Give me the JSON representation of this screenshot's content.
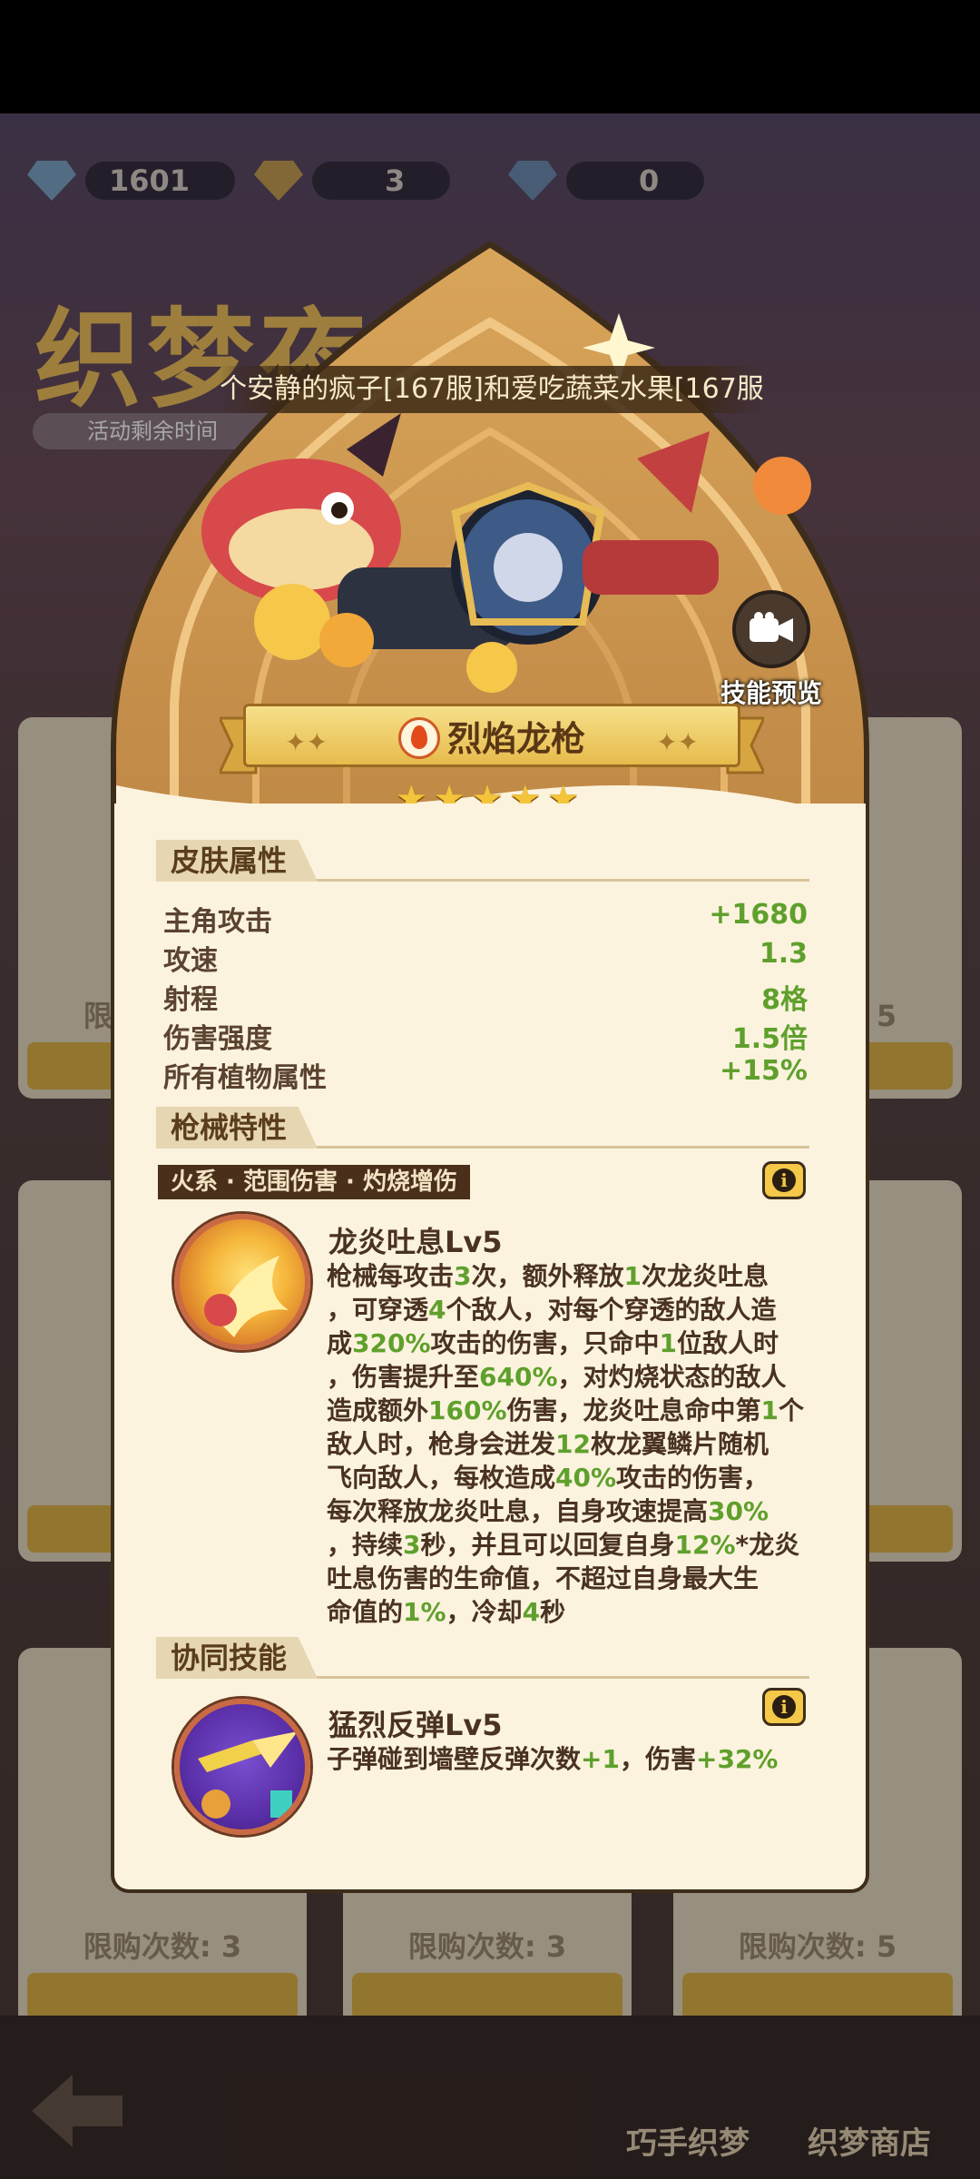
{
  "background": {
    "resources": [
      {
        "icon": "diamond-icon",
        "value": "1601"
      },
      {
        "icon": "mask-icon",
        "value": "3"
      },
      {
        "icon": "crystal-icon",
        "value": "0"
      }
    ],
    "title": "织梦夜",
    "timer_label": "活动剩余时间",
    "card_limit_text": [
      "限购次数: 3",
      "限购次数: 3",
      "限购次数: 5"
    ],
    "bottom_tabs": [
      "巧手织梦",
      "织梦商店"
    ]
  },
  "modal": {
    "banner_prefix": "个安静的疯子[167服]",
    "banner_join": "和",
    "banner_suffix": "爱吃蔬菜水果[167服",
    "preview_label": "技能预览",
    "skin_name": "烈焰龙枪",
    "stars": "★★★★★",
    "star_count": 5,
    "sections": {
      "attributes": "皮肤属性",
      "gun_traits": "枪械特性",
      "synergy": "协同技能"
    },
    "attributes": [
      {
        "label": "主角攻击",
        "value": "+1680"
      },
      {
        "label": "攻速",
        "value": "1.3"
      },
      {
        "label": "射程",
        "value": "8格"
      },
      {
        "label": "伤害强度",
        "value": "1.5倍"
      },
      {
        "label": "所有植物属性",
        "value": "+15%"
      }
    ],
    "tags": "火系 · 范围伤害 · 灼烧增伤",
    "skill1": {
      "name": "龙炎吐息Lv5",
      "desc_lines": [
        "枪械每攻击3次，额外释放1次龙炎吐息",
        "，可穿透4个敌人，对每个穿透的敌人造",
        "成320%攻击的伤害，只命中1位敌人时",
        "，伤害提升至640%，对灼烧状态的敌人",
        "造成额外160%伤害，龙炎吐息命中第1个",
        "敌人时，枪身会迸发12枚龙翼鳞片随机",
        "飞向敌人，每枚造成40%攻击的伤害，",
        "每次释放龙炎吐息，自身攻速提高30%",
        "，持续3秒，并且可以回复自身12%*龙炎",
        "吐息伤害的生命值，不超过自身最大生",
        "命值的1%，冷却4秒"
      ]
    },
    "skill2": {
      "name": "猛烈反弹Lv5",
      "desc": "子弹碰到墙壁反弹次数+1，伤害+32%"
    },
    "colors": {
      "highlight_green": "#5fa02c",
      "panel_bg": "#fbf3de",
      "text_brown": "#4a3222"
    }
  }
}
